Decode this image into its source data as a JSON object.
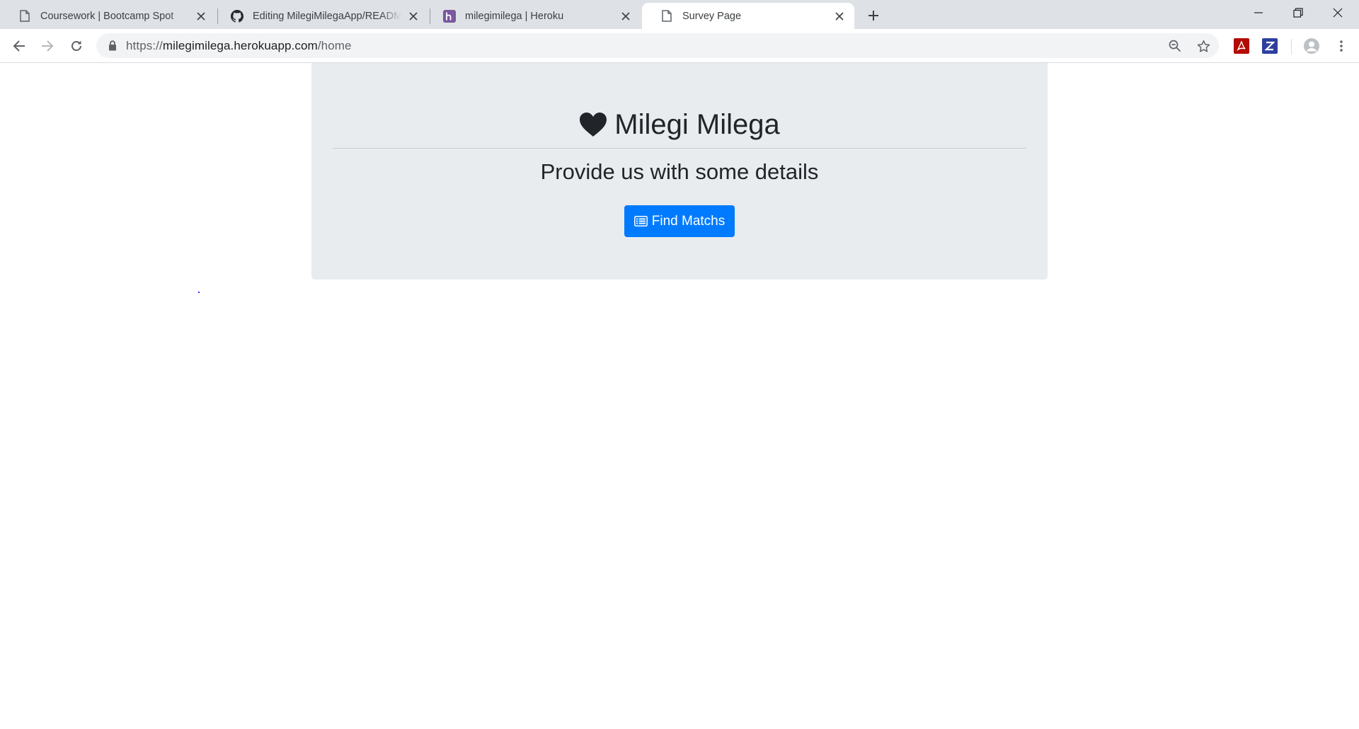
{
  "browser": {
    "tabs": [
      {
        "title": "Coursework | Bootcamp Spot",
        "favicon": "document-icon"
      },
      {
        "title": "Editing MilegiMilegaApp/README.md",
        "favicon": "github-icon"
      },
      {
        "title": "milegimilega | Heroku",
        "favicon": "heroku-icon"
      },
      {
        "title": "Survey Page",
        "favicon": "document-icon",
        "active": true
      }
    ],
    "address": {
      "scheme": "https://",
      "host": "milegimilega.herokuapp.com",
      "path": "/home"
    }
  },
  "page": {
    "title": "Milegi Milega",
    "title_icon": "heart-icon",
    "subtitle": "Provide us with some details",
    "button_label": "Find Matchs",
    "button_icon": "list-alt-icon"
  },
  "colors": {
    "primary": "#007bff",
    "jumbotron_bg": "#e9ecef",
    "text": "#212529",
    "tabstrip_bg": "#dee1e6",
    "heroku_purple": "#79589f"
  }
}
